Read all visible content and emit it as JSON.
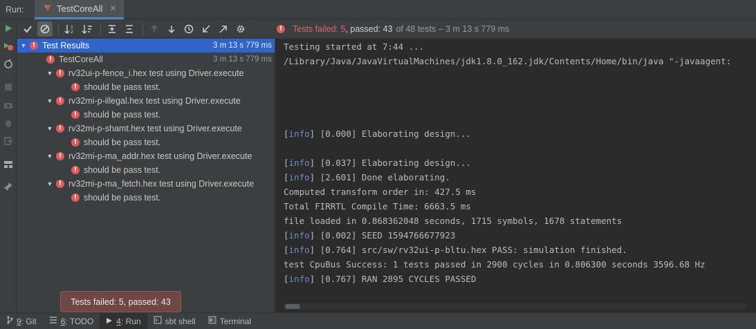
{
  "tabbar": {
    "run_label": "Run:",
    "tab_title": "TestCoreAll",
    "close_glyph": "✕"
  },
  "toolbar": {
    "status_failed": "Tests failed: 5",
    "status_passed": ", passed: 43",
    "status_rest": "of 48 tests – 3 m 13 s 779 ms"
  },
  "tree": {
    "root": {
      "label": "Test Results",
      "time": "3 m 13 s 779 ms"
    },
    "suite": {
      "label": "TestCoreAll",
      "time": "3 m 13 s 779 ms"
    },
    "tests": [
      {
        "label": "rv32ui-p-fence_i.hex test using Driver.execute",
        "child": "should be pass test."
      },
      {
        "label": "rv32mi-p-illegal.hex test using Driver.execute",
        "child": "should be pass test."
      },
      {
        "label": "rv32mi-p-shamt.hex test using Driver.execute",
        "child": "should be pass test."
      },
      {
        "label": "rv32mi-p-ma_addr.hex test using Driver.execute",
        "child": "should be pass test."
      },
      {
        "label": "rv32mi-p-ma_fetch.hex test using Driver.execute",
        "child": "should be pass test."
      }
    ]
  },
  "console": {
    "info_tag": "info",
    "lines": {
      "l1": "Testing started at 7:44 ...",
      "l2": "/Library/Java/JavaVirtualMachines/jdk1.8.0_162.jdk/Contents/Home/bin/java \"-javaagent:",
      "l3": "[0.000] Elaborating design...",
      "l4": "[0.037] Elaborating design...",
      "l5": "[2.601] Done elaborating.",
      "l6": "Computed transform order in: 427.5 ms",
      "l7": "Total FIRRTL Compile Time: 6663.5 ms",
      "l8": "file loaded in 0.868362048 seconds, 1715 symbols, 1678 statements",
      "l9": "[0.002] SEED 1594766677923",
      "l10": "[0.764] src/sw/rv32ui-p-bltu.hex PASS: simulation finished.",
      "l11": "test CpuBus Success: 1 tests passed in 2900 cycles in 0.806300 seconds 3596.68 Hz",
      "l12": "[0.767] RAN 2895 CYCLES PASSED"
    }
  },
  "tooltip": {
    "text": "Tests failed: 5, passed: 43"
  },
  "bottombar": {
    "git": {
      "num": "9",
      "label": ": Git"
    },
    "todo": {
      "num": "6",
      "label": ": TODO"
    },
    "run": {
      "num": "4",
      "label": ": Run"
    },
    "sbt": {
      "label": "sbt shell"
    },
    "terminal": {
      "label": "Terminal"
    }
  },
  "colors": {
    "accent": "#2f65ca",
    "error": "#db5c5c",
    "run_green": "#59a869",
    "tooltip_bg": "#704745"
  }
}
